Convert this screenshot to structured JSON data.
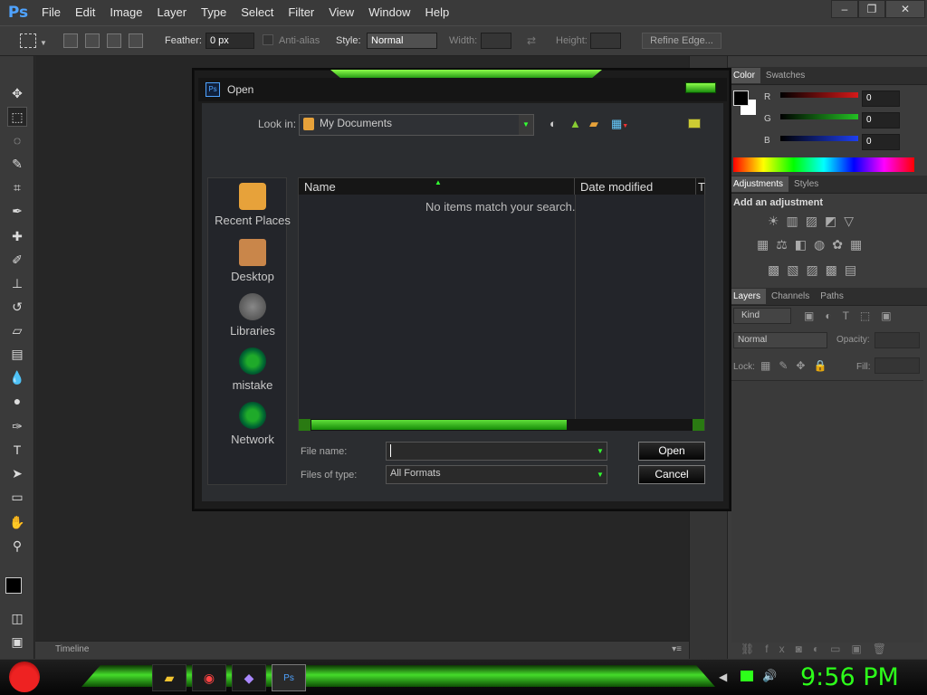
{
  "menubar": {
    "logo": "Ps",
    "items": [
      "File",
      "Edit",
      "Image",
      "Layer",
      "Type",
      "Select",
      "Filter",
      "View",
      "Window",
      "Help"
    ],
    "window_controls": [
      "–",
      "❐",
      "✕"
    ]
  },
  "options_bar": {
    "feather_label": "Feather:",
    "feather_value": "0 px",
    "antialias_label": "Anti-alias",
    "style_label": "Style:",
    "style_value": "Normal",
    "width_label": "Width:",
    "height_label": "Height:",
    "refine_edge": "Refine Edge..."
  },
  "timeline": {
    "label": "Timeline"
  },
  "panels": {
    "color_tabs": [
      "Color",
      "Swatches"
    ],
    "rgb": [
      {
        "label": "R",
        "value": "0",
        "color": "#d51919"
      },
      {
        "label": "G",
        "value": "0",
        "color": "#23c023"
      },
      {
        "label": "B",
        "value": "0",
        "color": "#1e3ff0"
      }
    ],
    "adjust_tabs": [
      "Adjustments",
      "Styles"
    ],
    "add_adjustment": "Add an adjustment",
    "layers_tabs": [
      "Layers",
      "Channels",
      "Paths"
    ],
    "kind": "Kind",
    "blend_mode": "Normal",
    "opacity_label": "Opacity:",
    "lock_label": "Lock:",
    "fill_label": "Fill:"
  },
  "dialog": {
    "title": "Open",
    "look_in_label": "Look in:",
    "look_in_value": "My Documents",
    "places": [
      {
        "label": "Recent Places",
        "icon": "recent-places-icon",
        "color": "#e7a23a"
      },
      {
        "label": "Desktop",
        "icon": "desktop-icon",
        "color": "#c9864a"
      },
      {
        "label": "Libraries",
        "icon": "libraries-icon",
        "color": "#666666"
      },
      {
        "label": "mistake",
        "icon": "user-folder-icon",
        "color": "#1faa2a"
      },
      {
        "label": "Network",
        "icon": "network-icon",
        "color": "#1faa2a"
      }
    ],
    "columns": [
      "Name",
      "Date modified",
      "T"
    ],
    "empty_message": "No items match your search.",
    "file_name_label": "File name:",
    "file_name_value": "",
    "files_of_type_label": "Files of type:",
    "files_of_type_value": "All Formats",
    "open_button": "Open",
    "cancel_button": "Cancel"
  },
  "taskbar": {
    "clock": "9:56 PM",
    "accent": "#2dff1a"
  }
}
